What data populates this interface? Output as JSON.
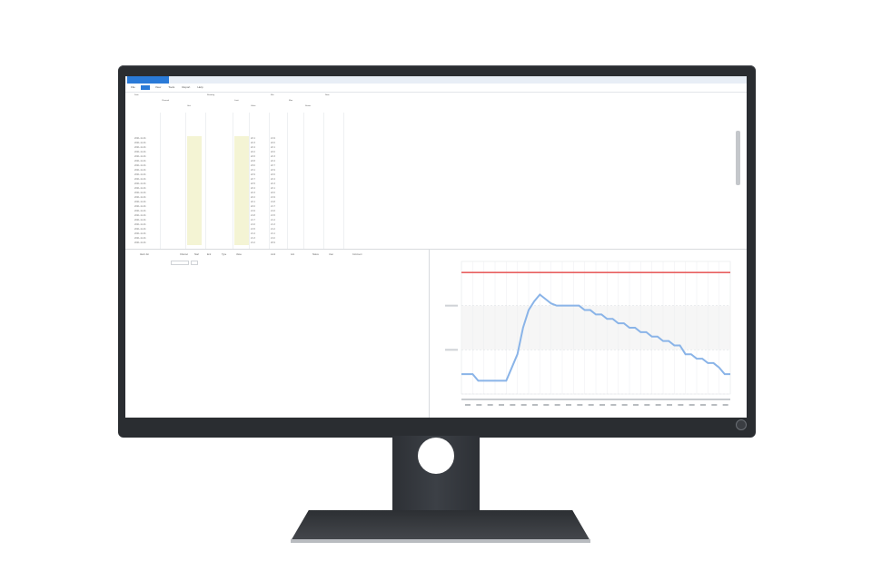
{
  "toolbar": {
    "buttons": [
      "File",
      "",
      "View",
      "Tools",
      "Report",
      "Help"
    ]
  },
  "table": {
    "headers": [
      "Date",
      "Channel",
      "Unit",
      "Reading",
      "Limit",
      "Value",
      "Min",
      "Max",
      "Status",
      "Note"
    ],
    "rows": [
      [
        "2021-11-01",
        "",
        "",
        "",
        "",
        "22.1",
        "21.9",
        ""
      ],
      [
        "2021-11-01",
        "",
        "",
        "",
        "",
        "22.3",
        "22.0",
        ""
      ],
      [
        "2021-11-01",
        "",
        "",
        "",
        "",
        "22.4",
        "22.1",
        ""
      ],
      [
        "2021-11-01",
        "",
        "",
        "",
        "",
        "22.2",
        "22.0",
        ""
      ],
      [
        "2021-11-01",
        "",
        "",
        "",
        "",
        "22.6",
        "22.3",
        ""
      ],
      [
        "2021-11-01",
        "",
        "",
        "",
        "",
        "22.8",
        "22.4",
        ""
      ],
      [
        "2021-11-01",
        "",
        "",
        "",
        "",
        "23.0",
        "22.7",
        ""
      ],
      [
        "2021-11-01",
        "",
        "",
        "",
        "",
        "23.1",
        "22.9",
        ""
      ],
      [
        "2021-11-01",
        "",
        "",
        "",
        "",
        "22.9",
        "22.6",
        ""
      ],
      [
        "2021-11-01",
        "",
        "",
        "",
        "",
        "22.7",
        "22.4",
        ""
      ],
      [
        "2021-11-01",
        "",
        "",
        "",
        "",
        "22.5",
        "22.3",
        ""
      ],
      [
        "2021-11-01",
        "",
        "",
        "",
        "",
        "22.4",
        "22.1",
        ""
      ],
      [
        "2021-11-01",
        "",
        "",
        "",
        "",
        "22.3",
        "22.0",
        ""
      ],
      [
        "2021-11-01",
        "",
        "",
        "",
        "",
        "22.2",
        "21.9",
        ""
      ],
      [
        "2021-11-01",
        "",
        "",
        "",
        "",
        "22.1",
        "21.8",
        ""
      ],
      [
        "2021-11-01",
        "",
        "",
        "",
        "",
        "22.0",
        "21.7",
        ""
      ],
      [
        "2021-11-01",
        "",
        "",
        "",
        "",
        "21.9",
        "21.6",
        ""
      ],
      [
        "2021-11-01",
        "",
        "",
        "",
        "",
        "21.8",
        "21.5",
        ""
      ],
      [
        "2021-11-01",
        "",
        "",
        "",
        "",
        "21.7",
        "21.4",
        ""
      ],
      [
        "2021-11-01",
        "",
        "",
        "",
        "",
        "21.6",
        "21.3",
        ""
      ],
      [
        "2021-11-01",
        "",
        "",
        "",
        "",
        "21.5",
        "21.2",
        ""
      ],
      [
        "2021-11-01",
        "",
        "",
        "",
        "",
        "21.4",
        "21.1",
        ""
      ],
      [
        "2021-11-01",
        "",
        "",
        "",
        "",
        "21.3",
        "21.0",
        ""
      ],
      [
        "2021-11-01",
        "",
        "",
        "",
        "",
        "21.2",
        "20.9",
        ""
      ]
    ],
    "footer": [
      "",
      ""
    ]
  },
  "lower_panel": {
    "headers": [
      "Alarm list",
      "Channel",
      "Start",
      "End",
      "Type",
      "Value",
      "Limit",
      "Ack",
      "Status",
      "User",
      "Comment"
    ]
  },
  "chart_data": {
    "type": "line",
    "title": "",
    "xlabel": "",
    "ylabel": "",
    "ylim": [
      0,
      60
    ],
    "x": [
      0,
      1,
      2,
      3,
      4,
      5,
      6,
      7,
      8,
      9,
      10,
      11,
      12,
      13,
      14,
      15,
      16,
      17,
      18,
      19,
      20,
      21,
      22,
      23,
      24,
      25,
      26,
      27,
      28,
      29,
      30,
      31,
      32,
      33,
      34,
      35,
      36,
      37,
      38,
      39,
      40,
      41,
      42,
      43,
      44,
      45,
      46,
      47,
      48
    ],
    "series": [
      {
        "color": "#e86060",
        "values": [
          55,
          55,
          55,
          55,
          55,
          55,
          55,
          55,
          55,
          55,
          55,
          55,
          55,
          55,
          55,
          55,
          55,
          55,
          55,
          55,
          55,
          55,
          55,
          55,
          55,
          55,
          55,
          55,
          55,
          55,
          55,
          55,
          55,
          55,
          55,
          55,
          55,
          55,
          55,
          55,
          55,
          55,
          55,
          55,
          55,
          55,
          55,
          55,
          55
        ]
      },
      {
        "color": "#8ab4e8",
        "values": [
          9,
          9,
          9,
          6,
          6,
          6,
          6,
          6,
          6,
          12,
          18,
          30,
          38,
          42,
          45,
          43,
          41,
          40,
          40,
          40,
          40,
          40,
          38,
          38,
          36,
          36,
          34,
          34,
          32,
          32,
          30,
          30,
          28,
          28,
          26,
          26,
          24,
          24,
          22,
          22,
          18,
          18,
          16,
          16,
          14,
          14,
          12,
          9,
          9
        ]
      }
    ],
    "grid": true,
    "legend": "none"
  },
  "colors": {
    "accent": "#2a7ad8",
    "limit_line": "#e86060",
    "series_line": "#8ab4e8",
    "bezel": "#2a2d31"
  }
}
